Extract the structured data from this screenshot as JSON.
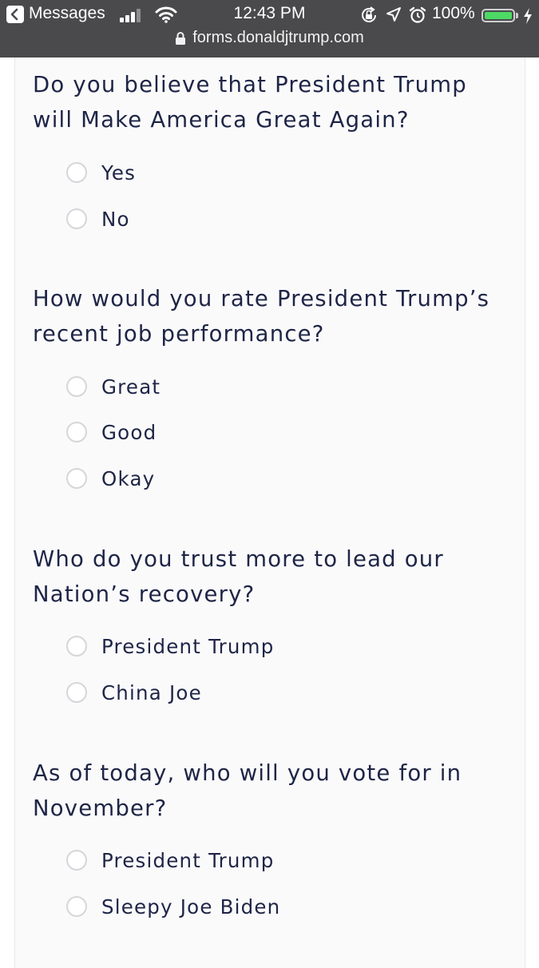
{
  "status_bar": {
    "back_label": "Messages",
    "time": "12:43 PM",
    "battery_text": "100%",
    "battery_level": 1.0,
    "signal_bars_active": 3,
    "signal_bars_total": 4,
    "icons": [
      "signal-icon",
      "wifi-icon",
      "screen-lock-icon",
      "location-icon",
      "alarm-icon",
      "battery-icon",
      "charging-bolt-icon"
    ],
    "colors": {
      "bar_bg": "#4a4a4c",
      "battery_green": "#4cd964"
    }
  },
  "browser": {
    "url": "forms.donaldjtrump.com",
    "secure_icon": "lock-icon"
  },
  "form": {
    "text_color": "#1e2546",
    "questions": [
      {
        "text": "Do you believe that President Trump will Make America Great Again?",
        "options": [
          "Yes",
          "No"
        ]
      },
      {
        "text": "How would you rate President Trump’s recent job performance?",
        "options": [
          "Great",
          "Good",
          "Okay"
        ]
      },
      {
        "text": "Who do you trust more to lead our Nation’s recovery?",
        "options": [
          "President Trump",
          "China Joe"
        ]
      },
      {
        "text": "As of today, who will you vote for in November?",
        "options": [
          "President Trump",
          "Sleepy Joe Biden"
        ]
      }
    ]
  }
}
